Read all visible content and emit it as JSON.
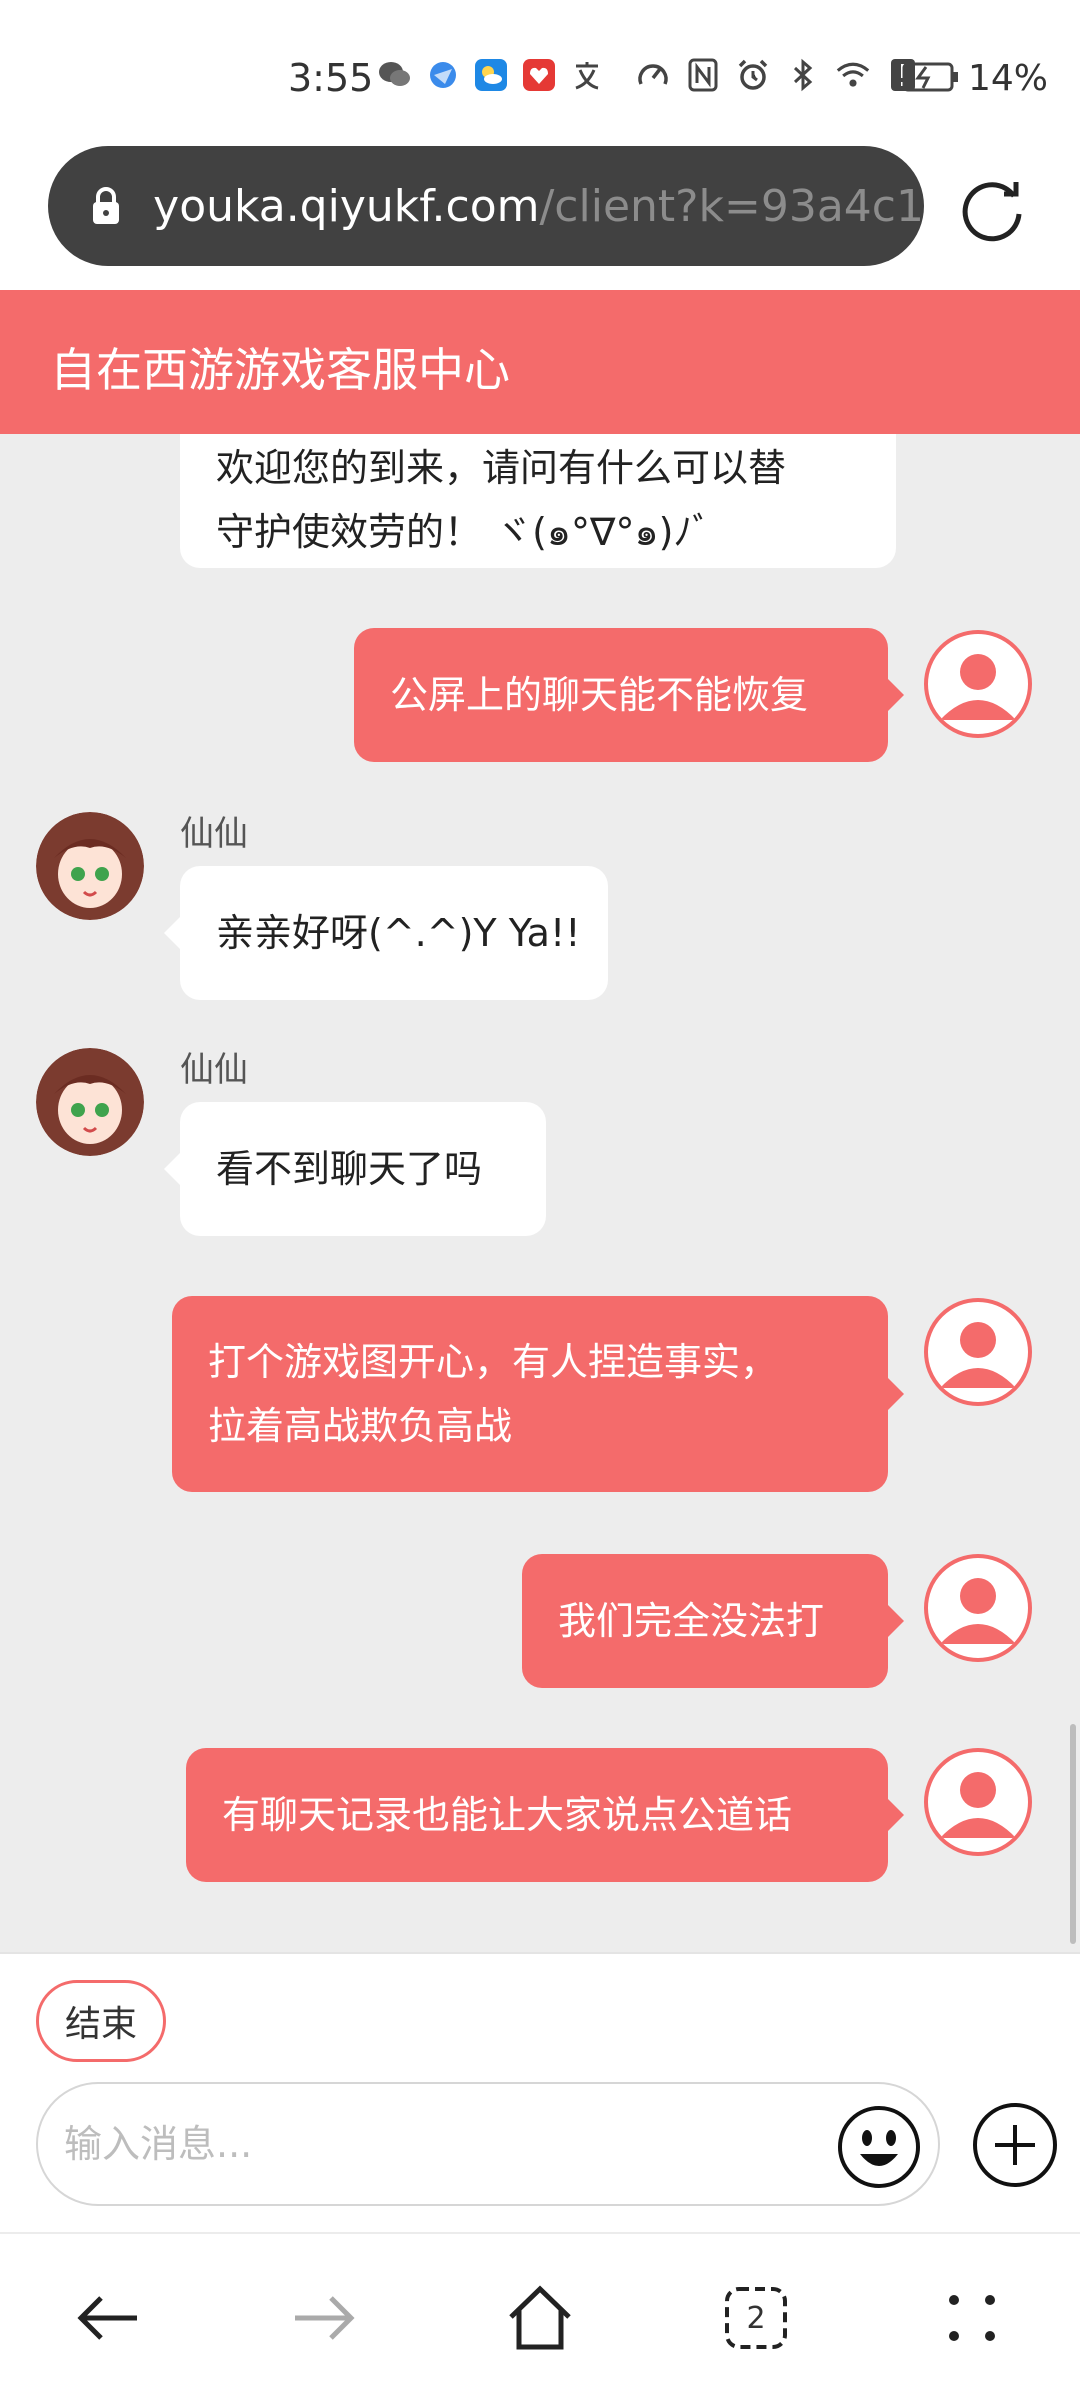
{
  "status_bar": {
    "time": "3:55",
    "battery": "14%"
  },
  "browser": {
    "url_host": "youka.qiyukf.com",
    "url_path": "/client?k=93a4c1",
    "tab_count": "2"
  },
  "header": {
    "title": "自在西游游戏客服中心"
  },
  "chat": {
    "messages": [
      {
        "side": "in",
        "lines": [
          "欢迎您的到来，请问有什么可以替",
          "守护使效劳的！ ヾ(๑°∇°๑)ﾉﾞ"
        ]
      },
      {
        "side": "out",
        "text": "公屏上的聊天能不能恢复"
      },
      {
        "side": "in",
        "sender": "仙仙",
        "text": "亲亲好呀(^.^)Y Ya!!"
      },
      {
        "side": "in",
        "sender": "仙仙",
        "text": "看不到聊天了吗"
      },
      {
        "side": "out",
        "lines": [
          "打个游戏图开心，有人捏造事实，",
          "拉着高战欺负高战"
        ]
      },
      {
        "side": "out",
        "text": "我们完全没法打"
      },
      {
        "side": "out",
        "text": "有聊天记录也能让大家说点公道话"
      }
    ]
  },
  "actions": {
    "end_label": "结束",
    "input_placeholder": "输入消息..."
  },
  "colors": {
    "accent": "#f46b6b",
    "chat_bg": "#ededed",
    "url_bar": "#414141"
  },
  "icons": [
    "wechat-icon",
    "browser-icon",
    "weather-icon",
    "app-icon",
    "translate-icon",
    "speed-icon",
    "nfc-icon",
    "alarm-icon",
    "bluetooth-icon",
    "wifi-icon",
    "alert-icon",
    "battery-icon",
    "lock-icon",
    "reload-icon",
    "emoji-icon",
    "plus-icon",
    "back-icon",
    "forward-icon",
    "home-icon",
    "tabs-icon",
    "menu-icon"
  ]
}
